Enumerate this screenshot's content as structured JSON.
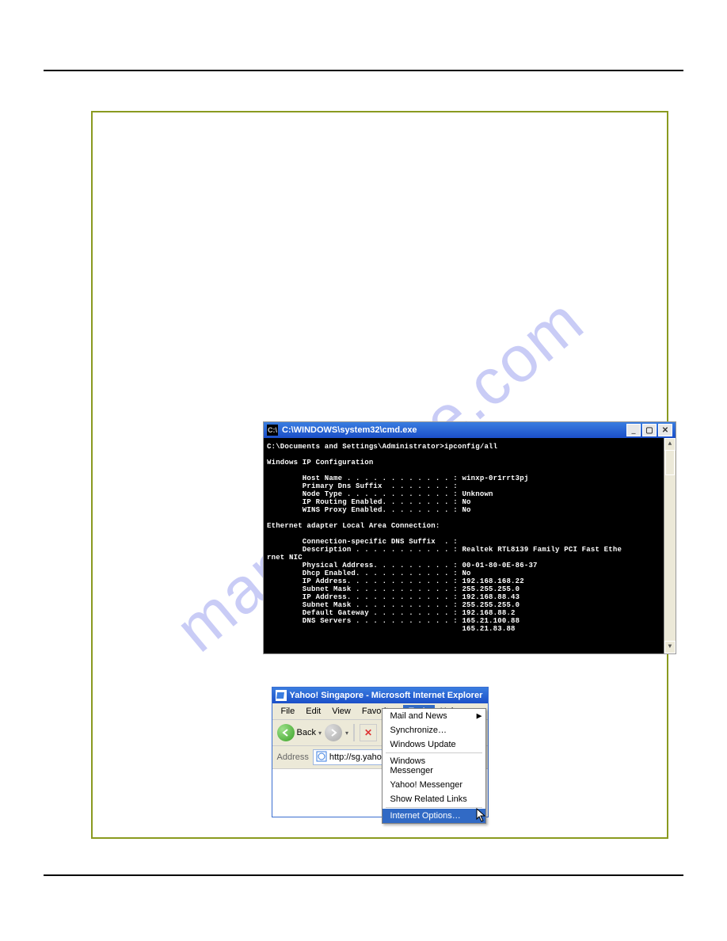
{
  "watermark": "manualslive.com",
  "cmd": {
    "title": "C:\\WINDOWS\\system32\\cmd.exe",
    "icon_glyph": "C:\\",
    "body": "C:\\Documents and Settings\\Administrator>ipconfig/all\n\nWindows IP Configuration\n\n        Host Name . . . . . . . . . . . . : winxp-0r1rrt3pj\n        Primary Dns Suffix  . . . . . . . :\n        Node Type . . . . . . . . . . . . : Unknown\n        IP Routing Enabled. . . . . . . . : No\n        WINS Proxy Enabled. . . . . . . . : No\n\nEthernet adapter Local Area Connection:\n\n        Connection-specific DNS Suffix  . :\n        Description . . . . . . . . . . . : Realtek RTL8139 Family PCI Fast Ethe\nrnet NIC\n        Physical Address. . . . . . . . . : 00-01-80-0E-86-37\n        Dhcp Enabled. . . . . . . . . . . : No\n        IP Address. . . . . . . . . . . . : 192.168.168.22\n        Subnet Mask . . . . . . . . . . . : 255.255.255.0\n        IP Address. . . . . . . . . . . . : 192.168.88.43\n        Subnet Mask . . . . . . . . . . . : 255.255.255.0\n        Default Gateway . . . . . . . . . : 192.168.88.2\n        DNS Servers . . . . . . . . . . . : 165.21.100.88\n                                            165.21.83.88"
  },
  "ie": {
    "title": "Yahoo! Singapore - Microsoft Internet Explorer",
    "menus": {
      "file": "File",
      "edit": "Edit",
      "view": "View",
      "favorites": "Favorites",
      "tools": "Tools",
      "help": "Help"
    },
    "back_label": "Back",
    "dropdown_arrow": "▾",
    "stop_glyph": "✕",
    "address_label": "Address",
    "address_value": "http://sg.yahoo.com",
    "tools_menu": {
      "mail_and_news": "Mail and News",
      "synchronize": "Synchronize…",
      "windows_update": "Windows Update",
      "windows_messenger": "Windows Messenger",
      "yahoo_messenger": "Yahoo! Messenger",
      "show_related": "Show Related Links",
      "internet_options": "Internet Options…"
    }
  }
}
